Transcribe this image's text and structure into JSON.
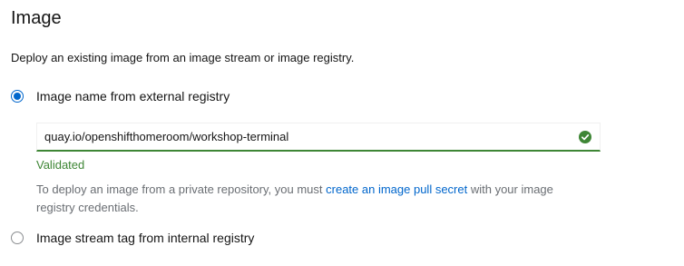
{
  "section": {
    "title": "Image",
    "description": "Deploy an existing image from an image stream or image registry."
  },
  "options": [
    {
      "label": "Image name from external registry",
      "checked": true
    },
    {
      "label": "Image stream tag from internal registry",
      "checked": false
    }
  ],
  "image_input": {
    "value": "quay.io/openshifthomeroom/workshop-terminal",
    "status_icon": "check-circle-icon",
    "validated_text": "Validated"
  },
  "helper": {
    "before": "To deploy an image from a private repository, you must ",
    "link": "create an image pull secret",
    "after": " with your image registry credentials."
  },
  "colors": {
    "accent": "#0066cc",
    "success": "#3e8635",
    "muted": "#6a6e73"
  }
}
